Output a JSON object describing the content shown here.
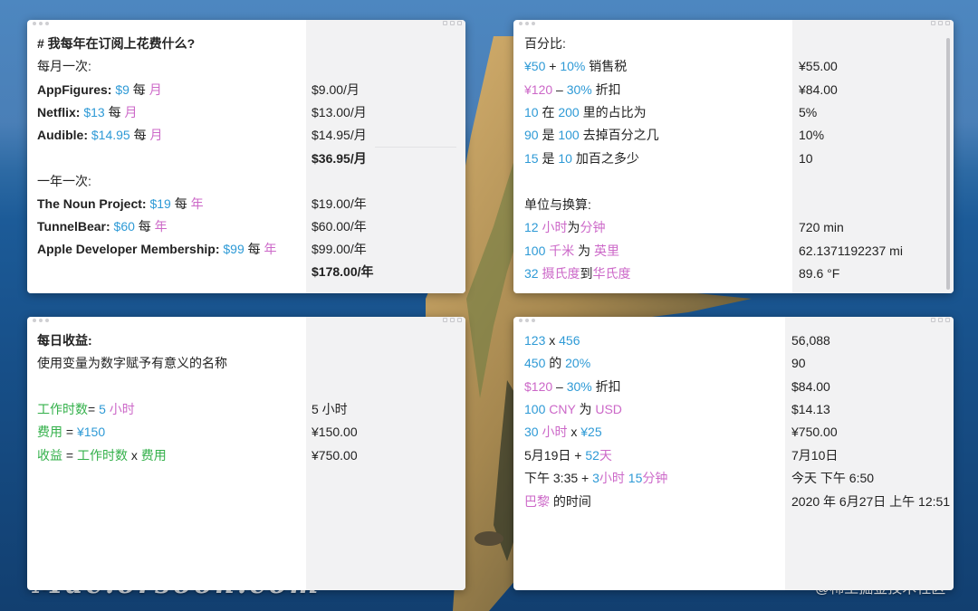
{
  "branding": {
    "watermark": "Mac.orsoon.com",
    "credit": "@稀土掘金技术社区"
  },
  "w1": {
    "heading": "# 我每年在订阅上花费什么?",
    "monthly_title": "每月一次:",
    "af": {
      "name": "AppFigures: ",
      "amount": "$9",
      "per": " 每 ",
      "unit": "月",
      "result": "$9.00/月"
    },
    "nf": {
      "name": "Netflix: ",
      "amount": "$13",
      "per": " 每 ",
      "unit": "月",
      "result": "$13.00/月"
    },
    "au": {
      "name": "Audible: ",
      "amount": "$14.95",
      "per": " 每 ",
      "unit": "月",
      "result": "$14.95/月"
    },
    "monthly_total": "$36.95/月",
    "yearly_title": "一年一次:",
    "np": {
      "name": "The Noun Project: ",
      "amount": "$19",
      "per": " 每 ",
      "unit": "年",
      "result": "$19.00/年"
    },
    "tb": {
      "name": "TunnelBear: ",
      "amount": "$60",
      "per": " 每 ",
      "unit": "年",
      "result": "$60.00/年"
    },
    "ad": {
      "name": "Apple Developer Membership: ",
      "amount": "$99",
      "per": " 每 ",
      "unit": "年",
      "result": "$99.00/年"
    },
    "yearly_total": "$178.00/年"
  },
  "w2": {
    "pct_title": "百分比:",
    "r1": {
      "a": "¥50",
      "b": " + ",
      "c": "10%",
      "d": " 销售税",
      "result": "¥55.00"
    },
    "r2": {
      "a": "¥120",
      "b": " – ",
      "c": "30%",
      "d": " 折扣",
      "result": "¥84.00"
    },
    "r3": {
      "a": "10",
      "b": " 在 ",
      "c": "200",
      "d": " 里的占比为",
      "result": "5%"
    },
    "r4": {
      "a": "90",
      "b": " 是 ",
      "c": "100",
      "d": " 去掉百分之几",
      "result": "10%"
    },
    "r5": {
      "a": "15",
      "b": " 是 ",
      "c": "10",
      "d": " 加百之多少",
      "result": "10"
    },
    "unit_title": "单位与换算:",
    "u1": {
      "a": "12",
      "b": " 小时",
      "c": "为",
      "d": "分钟",
      "result": "720 min"
    },
    "u2": {
      "a": "100",
      "b": " 千米",
      "c": " 为 ",
      "d": "英里",
      "result": "62.1371192237 mi"
    },
    "u3": {
      "a": "32",
      "b": " 摄氏度",
      "c": "到",
      "d": "华氏度",
      "result": "89.6 °F"
    }
  },
  "w3": {
    "title": "每日收益:",
    "desc": "使用变量为数字赋予有意义的名称",
    "v1": {
      "name": "工作时数",
      "eq": "= ",
      "num": "5",
      "unit": " 小时",
      "result": "5 小时"
    },
    "v2": {
      "name": "费用",
      "eq": " = ",
      "num": "¥150",
      "result": "¥150.00"
    },
    "v3": {
      "name": "收益",
      "eq": " = ",
      "a": "工作时数",
      "op": " x ",
      "b": "费用",
      "result": "¥750.00"
    }
  },
  "w4": {
    "l1": {
      "a": "123",
      "b": " x ",
      "c": "456",
      "result": "56,088"
    },
    "l2": {
      "a": "450",
      "b": " 的 ",
      "c": "20%",
      "result": "90"
    },
    "l3": {
      "a": "$120",
      "b": " – ",
      "c": "30%",
      "d": " 折扣",
      "result": "$84.00"
    },
    "l4": {
      "a": "100",
      "b": " CNY",
      "c": " 为 ",
      "d": "USD",
      "result": "$14.13"
    },
    "l5": {
      "a": "30",
      "b": " 小时",
      "c": " x ",
      "d": "¥25",
      "result": "¥750.00"
    },
    "l6": {
      "a": "5月19日 + ",
      "b": "52",
      "c": "天",
      "result": "7月10日"
    },
    "l7": {
      "a": "下午 3:35 + ",
      "b": "3",
      "c": "小时",
      "d": "15",
      "e": "分钟",
      "result": "今天 下午 6:50"
    },
    "l8": {
      "a": "巴黎",
      "b": " 的时间",
      "result": "2020 年 6月27日 上午 12:51"
    }
  },
  "colors": {
    "number_blue": "#2e9ad6",
    "unit_pink": "#cc68c8",
    "variable_green": "#33b04a",
    "answer_column": "#f2f2f3"
  }
}
